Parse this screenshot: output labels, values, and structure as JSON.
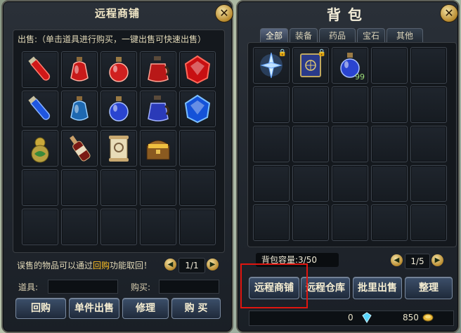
{
  "shop": {
    "title": "远程商铺",
    "close": "✕",
    "hint": "出售:（单击道具进行购买，一键出售可快速出售）",
    "buyback_hint_pre": "误售的物品可以通过",
    "buyback_hint_link": "回购",
    "buyback_hint_post": "功能取回！",
    "page": "1/1",
    "item_label": "道具:",
    "buy_label": "购买:",
    "buttons": [
      "回购",
      "单件出售",
      "修理",
      "购 买"
    ],
    "items": [
      {
        "icon": "red-potion-tube-icon"
      },
      {
        "icon": "red-potion-flask-icon"
      },
      {
        "icon": "red-potion-round-icon"
      },
      {
        "icon": "red-potion-jug-icon"
      },
      {
        "icon": "red-gem-icon"
      },
      {
        "icon": "blue-potion-tube-icon"
      },
      {
        "icon": "blue-potion-flask-icon"
      },
      {
        "icon": "blue-potion-round-icon"
      },
      {
        "icon": "blue-potion-jug-icon"
      },
      {
        "icon": "blue-gem-icon"
      },
      {
        "icon": "golden-gourd-icon"
      },
      {
        "icon": "wine-bottle-icon"
      },
      {
        "icon": "scroll-icon"
      },
      {
        "icon": "treasure-chest-icon"
      }
    ]
  },
  "bag": {
    "title": "背包",
    "close": "✕",
    "tabs": [
      "全部",
      "装备",
      "药品",
      "宝石",
      "其他"
    ],
    "active_tab": 0,
    "items": [
      {
        "icon": "crystal-sword-icon",
        "locked": true
      },
      {
        "icon": "spellbook-icon",
        "locked": true
      },
      {
        "icon": "blue-potion-round-icon",
        "qty": "99"
      }
    ],
    "capacity": "背包容量:3/50",
    "page": "1/5",
    "buttons": [
      "远程商铺",
      "远程仓库",
      "批里出售",
      "整理"
    ],
    "diamonds": "0",
    "gold": "850"
  },
  "colors": {
    "highlight": "#ffc125",
    "focus_frame": "#e0150f",
    "qty": "#9fe07a"
  }
}
